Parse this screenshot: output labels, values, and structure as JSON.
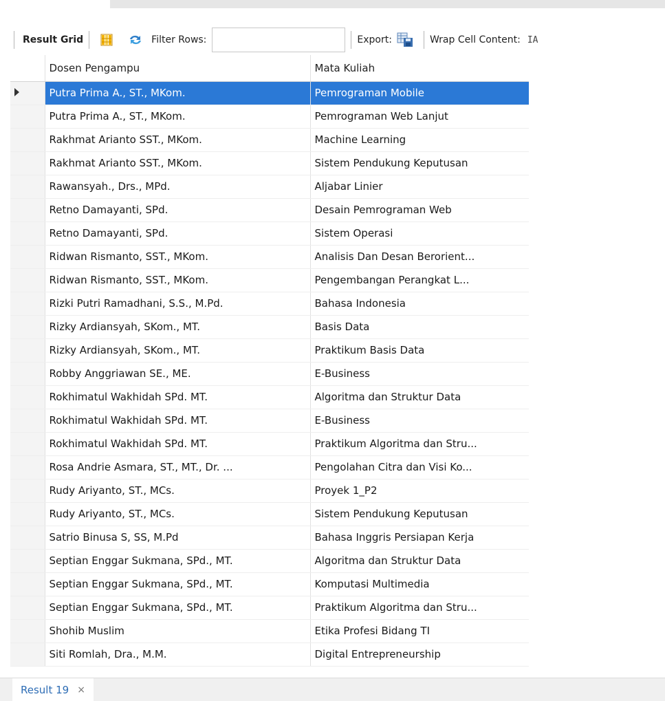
{
  "toolbar": {
    "result_grid_label": "Result Grid",
    "filter_label": "Filter Rows:",
    "filter_value": "",
    "export_label": "Export:",
    "wrap_label": "Wrap Cell Content:",
    "wrap_icon_text": "IA"
  },
  "table": {
    "columns": [
      "Dosen Pengampu",
      "Mata Kuliah"
    ],
    "selected_row": 0,
    "rows": [
      [
        "Putra Prima A., ST., MKom.",
        "Pemrograman Mobile"
      ],
      [
        "Putra Prima A., ST., MKom.",
        "Pemrograman Web Lanjut"
      ],
      [
        "Rakhmat Arianto SST., MKom.",
        "Machine Learning"
      ],
      [
        "Rakhmat Arianto SST., MKom.",
        "Sistem Pendukung Keputusan"
      ],
      [
        "Rawansyah., Drs., MPd.",
        "Aljabar Linier"
      ],
      [
        "Retno Damayanti, SPd.",
        "Desain Pemrograman Web"
      ],
      [
        "Retno Damayanti, SPd.",
        "Sistem Operasi"
      ],
      [
        "Ridwan Rismanto, SST., MKom.",
        "Analisis Dan Desan Berorient..."
      ],
      [
        "Ridwan Rismanto, SST., MKom.",
        "Pengembangan Perangkat L..."
      ],
      [
        "Rizki Putri Ramadhani, S.S., M.Pd.",
        "Bahasa Indonesia"
      ],
      [
        "Rizky Ardiansyah, SKom., MT.",
        "Basis Data"
      ],
      [
        "Rizky Ardiansyah, SKom., MT.",
        "Praktikum Basis Data"
      ],
      [
        "Robby Anggriawan SE., ME.",
        "E-Business"
      ],
      [
        "Rokhimatul Wakhidah SPd. MT.",
        "Algoritma dan Struktur Data"
      ],
      [
        "Rokhimatul Wakhidah SPd. MT.",
        "E-Business"
      ],
      [
        "Rokhimatul Wakhidah SPd. MT.",
        "Praktikum Algoritma dan Stru..."
      ],
      [
        "Rosa Andrie Asmara, ST., MT., Dr. ...",
        "Pengolahan Citra dan Visi Ko..."
      ],
      [
        "Rudy Ariyanto, ST., MCs.",
        "Proyek 1_P2"
      ],
      [
        "Rudy Ariyanto, ST., MCs.",
        "Sistem Pendukung Keputusan"
      ],
      [
        "Satrio Binusa S, SS, M.Pd",
        "Bahasa Inggris Persiapan Kerja"
      ],
      [
        "Septian Enggar Sukmana, SPd., MT.",
        "Algoritma dan Struktur Data"
      ],
      [
        "Septian Enggar Sukmana, SPd., MT.",
        "Komputasi Multimedia"
      ],
      [
        "Septian Enggar Sukmana, SPd., MT.",
        "Praktikum Algoritma dan Stru..."
      ],
      [
        "Shohib Muslim",
        "Etika Profesi Bidang TI"
      ],
      [
        "Siti Romlah, Dra., M.M.",
        "Digital Entrepreneurship"
      ]
    ]
  },
  "bottom_tab": {
    "label": "Result 19",
    "close_glyph": "×"
  },
  "colors": {
    "selection": "#2b79d6",
    "link_blue": "#2e6db5",
    "grid_icon": "#f5b400"
  },
  "icons": [
    "grid-layout-icon",
    "refresh-icon",
    "export-icon",
    "wrap-cell-icon",
    "row-pointer-icon",
    "close-icon"
  ]
}
